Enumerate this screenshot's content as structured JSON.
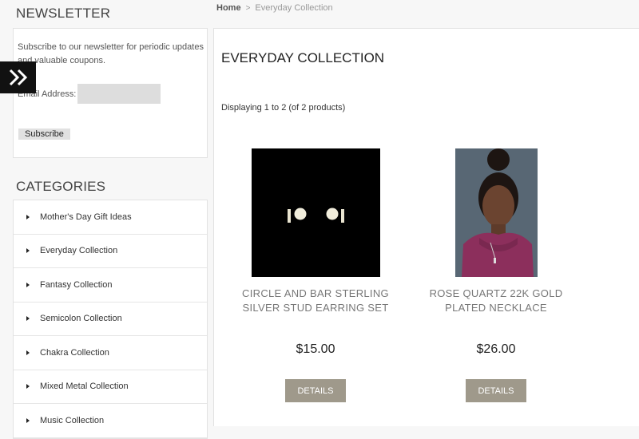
{
  "sidebar": {
    "newsletter": {
      "heading": "NEWSLETTER",
      "text": "Subscribe to our newsletter for periodic updates and valuable coupons.",
      "email_label": "Email Address:",
      "email_value": "",
      "subscribe_label": "Subscribe"
    },
    "categories": {
      "heading": "CATEGORIES",
      "items": [
        {
          "label": "Mother's Day Gift Ideas"
        },
        {
          "label": "Everyday Collection"
        },
        {
          "label": "Fantasy Collection"
        },
        {
          "label": "Semicolon Collection"
        },
        {
          "label": "Chakra Collection"
        },
        {
          "label": "Mixed Metal Collection"
        },
        {
          "label": "Music Collection"
        }
      ]
    },
    "toggle_icon": "double-chevron-right-icon"
  },
  "breadcrumb": {
    "home": "Home",
    "separator": ">",
    "current": "Everyday Collection"
  },
  "main": {
    "title": "EVERYDAY COLLECTION",
    "display_count": "Displaying 1 to 2 (of 2 products)",
    "products": [
      {
        "name_line1": "CIRCLE AND BAR STERLING",
        "name_line2": "SILVER STUD EARRING SET",
        "price": "$15.00",
        "button": "DETAILS"
      },
      {
        "name_line1": "ROSE QUARTZ 22K GOLD",
        "name_line2": "PLATED NECKLACE",
        "price": "$26.00",
        "button": "DETAILS"
      }
    ]
  },
  "colors": {
    "page_bg": "#f7f7f7",
    "details_button": "#9f998b",
    "toggle_bg": "#111111"
  }
}
